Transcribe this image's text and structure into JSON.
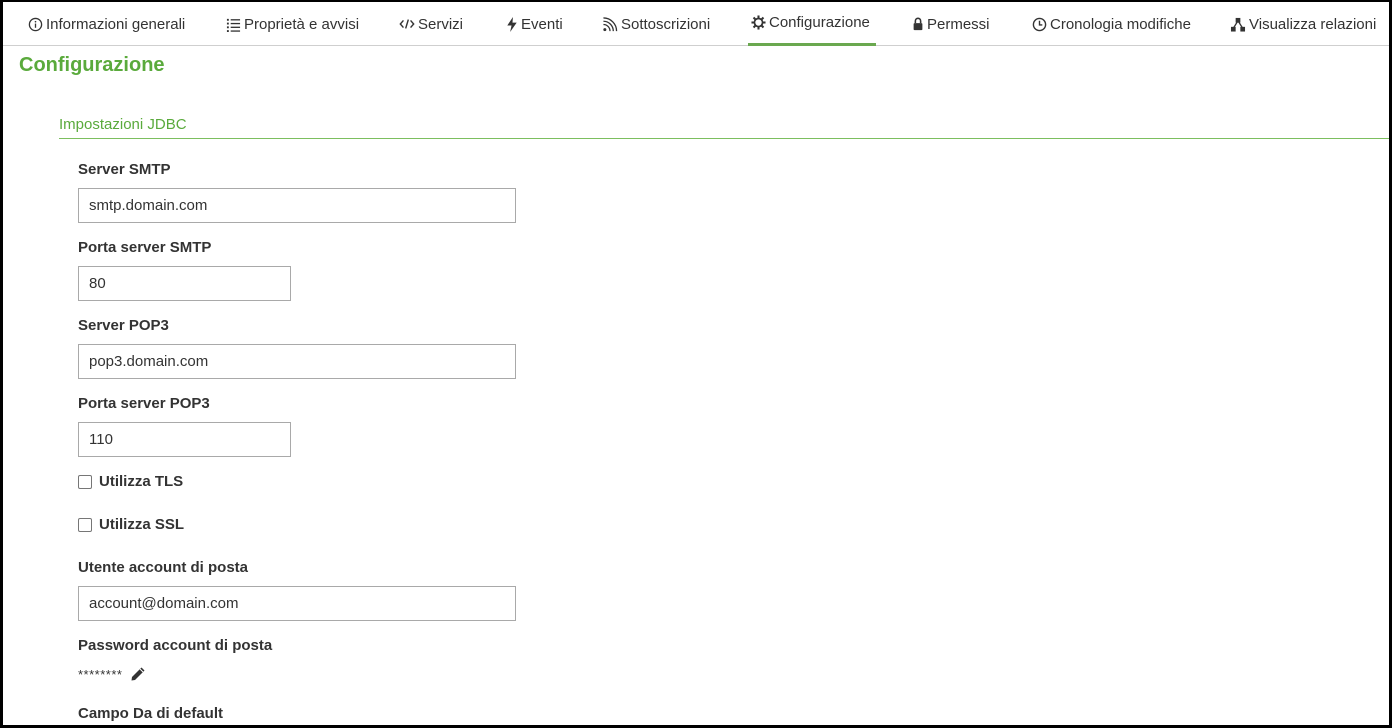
{
  "tabs": [
    {
      "label": "Informazioni generali",
      "icon": "info-icon"
    },
    {
      "label": "Proprietà e avvisi",
      "icon": "list-icon"
    },
    {
      "label": "Servizi",
      "icon": "code-icon"
    },
    {
      "label": "Eventi",
      "icon": "lightning-icon"
    },
    {
      "label": "Sottoscrizioni",
      "icon": "feed-icon"
    },
    {
      "label": "Configurazione",
      "icon": "gear-icon",
      "active": true
    },
    {
      "label": "Permessi",
      "icon": "lock-icon"
    },
    {
      "label": "Cronologia modifiche",
      "icon": "clock-icon"
    },
    {
      "label": "Visualizza relazioni",
      "icon": "relations-icon"
    }
  ],
  "page": {
    "title": "Configurazione"
  },
  "section": {
    "title": "Impostazioni JDBC"
  },
  "fields": {
    "smtp_server": {
      "label": "Server SMTP",
      "value": "smtp.domain.com"
    },
    "smtp_port": {
      "label": "Porta server SMTP",
      "value": "80"
    },
    "pop3_server": {
      "label": "Server POP3",
      "value": "pop3.domain.com"
    },
    "pop3_port": {
      "label": "Porta server POP3",
      "value": "110"
    },
    "use_tls": {
      "label": "Utilizza TLS",
      "checked": false
    },
    "use_ssl": {
      "label": "Utilizza SSL",
      "checked": false
    },
    "mail_user": {
      "label": "Utente account di posta",
      "value": "account@domain.com"
    },
    "mail_password": {
      "label": "Password account di posta",
      "masked": "********"
    },
    "default_from": {
      "label": "Campo Da di default"
    }
  },
  "colors": {
    "accent": "#5aaa3c",
    "tab_underline": "#6aa84f"
  }
}
